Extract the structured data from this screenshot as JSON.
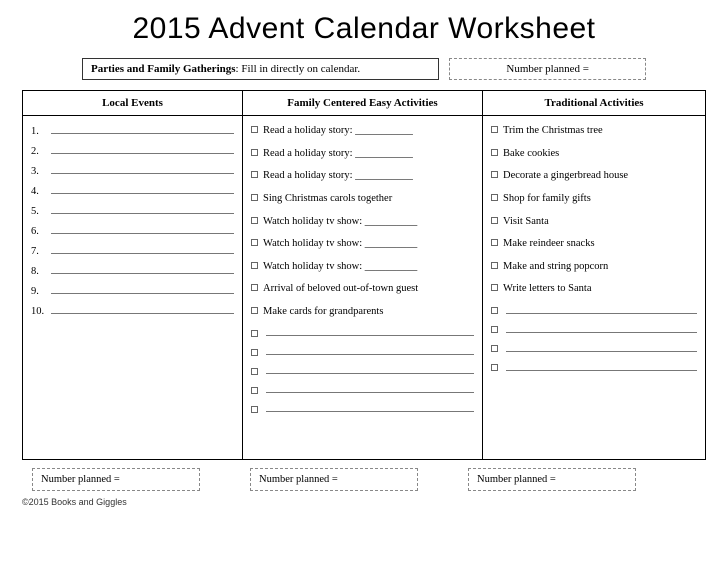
{
  "title": "2015 Advent Calendar Worksheet",
  "parties": {
    "label_bold": "Parties and Family Gatherings",
    "label_rest": ": Fill in directly on calendar."
  },
  "number_planned_label": "Number planned =",
  "columns": {
    "local": {
      "header": "Local Events",
      "numbers": [
        "1.",
        "2.",
        "3.",
        "4.",
        "5.",
        "6.",
        "7.",
        "8.",
        "9.",
        "10."
      ]
    },
    "family": {
      "header": "Family Centered Easy Activities",
      "items": [
        "Read a holiday story: ___________",
        "Read a holiday story: ___________",
        "Read a holiday story: ___________",
        "Sing Christmas carols together",
        "Watch holiday tv show: __________",
        "Watch holiday tv show: __________",
        "Watch holiday tv show: __________",
        "Arrival of beloved out-of-town guest",
        "Make cards for grandparents"
      ],
      "blanks": 5
    },
    "traditional": {
      "header": "Traditional Activities",
      "items": [
        "Trim the Christmas tree",
        "Bake cookies",
        "Decorate a gingerbread house",
        "Shop for family gifts",
        "Visit Santa",
        "Make reindeer snacks",
        "Make and string popcorn",
        "Write letters to Santa"
      ],
      "blanks": 4
    }
  },
  "footer_planned": [
    "Number planned =",
    "Number planned =",
    "Number planned ="
  ],
  "copyright": "©2015 Books and Giggles"
}
